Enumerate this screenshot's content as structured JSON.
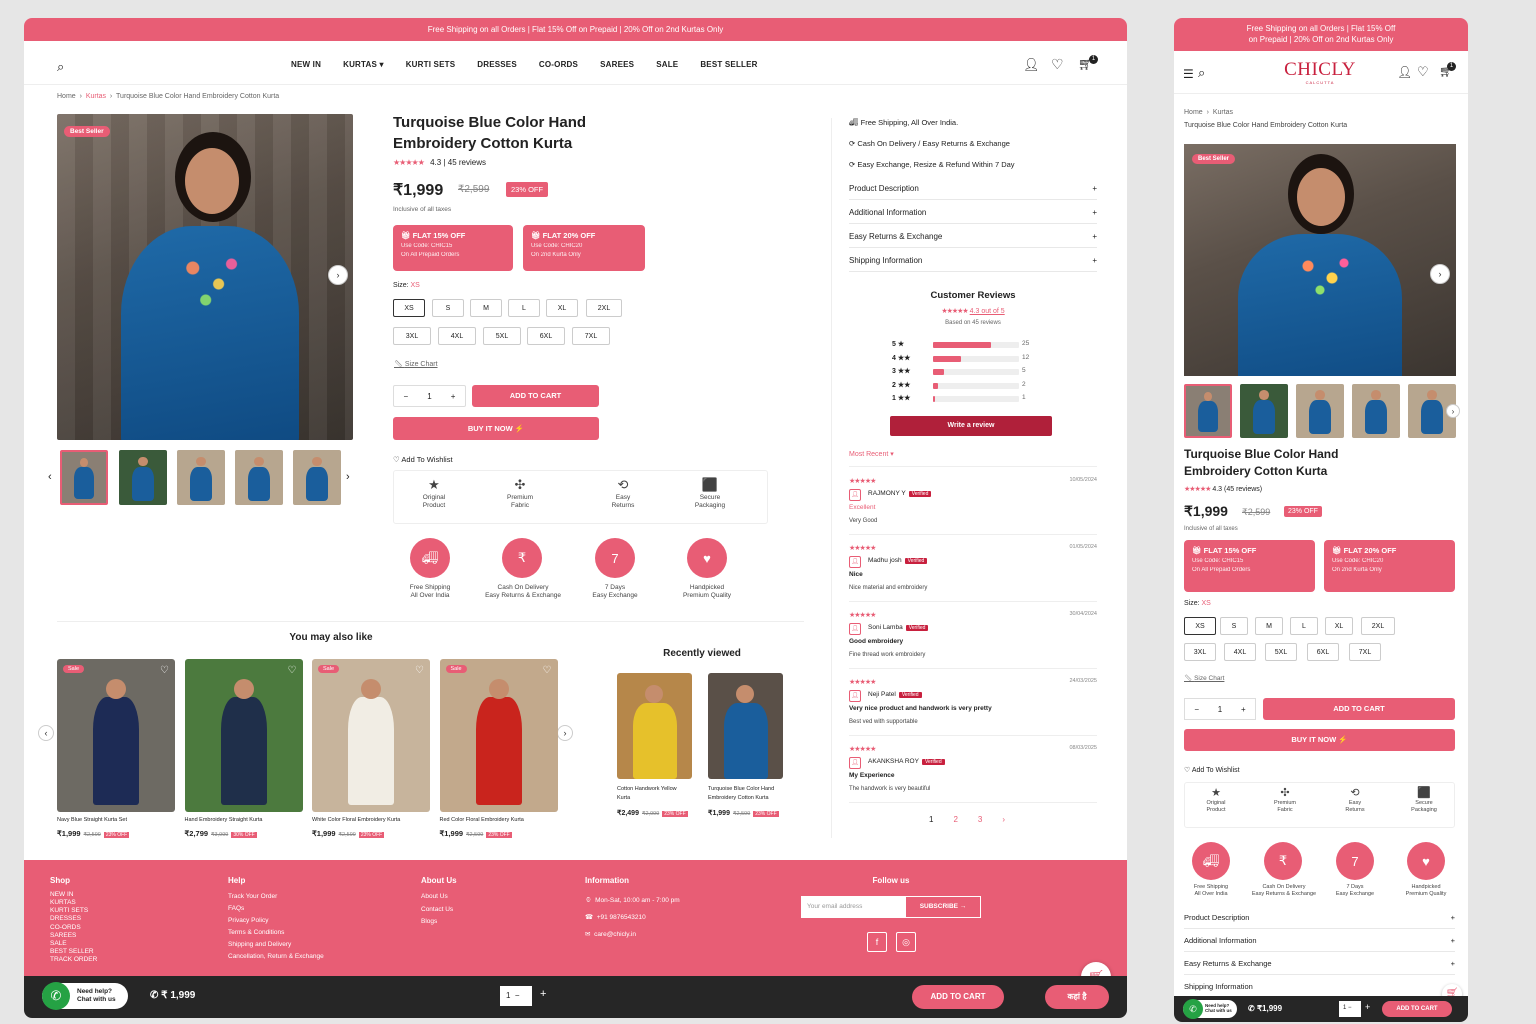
{
  "announcement": "Free Shipping on all Orders | Flat 15% Off on Prepaid | 20% Off on 2nd Kurtas Only",
  "mobile_announcement": [
    "Free Shipping on all Orders | Flat 15% Off",
    "on Prepaid | 20% Off on 2nd Kurtas Only"
  ],
  "brand": {
    "logo": "CHICLY",
    "sub": "CALCUTTA"
  },
  "nav": [
    "NEW IN",
    "KURTAS",
    "KURTI SETS",
    "DRESSES",
    "CO-ORDS",
    "SAREES",
    "SALE",
    "BEST SELLER"
  ],
  "cart_count": "1",
  "breadcrumb": {
    "home": "Home",
    "cat": "Kurtas",
    "current": "Turquoise Blue Color Hand Embroidery Cotton Kurta"
  },
  "product": {
    "badge": "Best Seller",
    "title_l1": "Turquoise Blue Color Hand",
    "title_l2": "Embroidery Cotton Kurta",
    "rating_text": "4.3 | 45 reviews",
    "mobile_rating_text": "4.3 (45 reviews)",
    "price": "₹1,999",
    "mrp": "₹2,599",
    "discount": "23% OFF",
    "tax_note": "Inclusive of all taxes",
    "size_label": "Size:",
    "size_selected": "XS",
    "sizes": [
      "XS",
      "S",
      "M",
      "L",
      "XL",
      "2XL",
      "3XL",
      "4XL",
      "5XL",
      "6XL",
      "7XL"
    ],
    "size_chart": "Size Chart",
    "qty": "1",
    "add_to_cart": "ADD TO CART",
    "buy_now": "BUY IT NOW",
    "wishlist": "Add To Wishlist"
  },
  "promos": [
    {
      "title": "FLAT 15% OFF",
      "code": "Use Code: CHIC15",
      "note": "On All Prepaid Orders"
    },
    {
      "title": "FLAT 20% OFF",
      "code": "Use Code: CHIC20",
      "note": "On 2nd Kurta Only"
    }
  ],
  "features": [
    {
      "l1": "Original",
      "l2": "Product",
      "icon": "star-icon"
    },
    {
      "l1": "Premium",
      "l2": "Fabric",
      "icon": "fabric-icon"
    },
    {
      "l1": "Easy",
      "l2": "Returns",
      "icon": "return-icon"
    },
    {
      "l1": "Secure",
      "l2": "Packaging",
      "icon": "box-icon"
    }
  ],
  "badges": [
    {
      "l1": "Free Shipping",
      "l2": "All Over India"
    },
    {
      "l1": "Cash On Delivery",
      "l2": "Easy Returns & Exchange"
    },
    {
      "l1": "7 Days",
      "l2": "Easy Exchange"
    },
    {
      "l1": "Handpicked",
      "l2": "Premium Quality"
    }
  ],
  "perks": [
    "Free Shipping, All Over India.",
    "Cash On Delivery / Easy Returns & Exchange",
    "Easy Exchange, Resize & Refund Within 7 Day"
  ],
  "accordion": [
    "Product Description",
    "Additional Information",
    "Easy Returns & Exchange",
    "Shipping Information"
  ],
  "reviews": {
    "heading": "Customer Reviews",
    "avg": "4.3 out of 5",
    "based": "Based on 45 reviews",
    "dist": [
      {
        "label": "5 ★",
        "count": "25",
        "frac": 0.56
      },
      {
        "label": "4 ★★",
        "count": "12",
        "frac": 0.27
      },
      {
        "label": "3 ★★",
        "count": "5",
        "frac": 0.11
      },
      {
        "label": "2 ★★",
        "count": "2",
        "frac": 0.05
      },
      {
        "label": "1 ★★",
        "count": "1",
        "frac": 0.02
      }
    ],
    "write": "Write a review",
    "sort": "Most Recent",
    "list": [
      {
        "name": "RAJMONY Y",
        "date": "10/05/2024",
        "title": "Excellent",
        "body": "Very Good"
      },
      {
        "name": "Madhu josh",
        "date": "01/05/2024",
        "title": "Nice",
        "body": "Nice material and embroidery"
      },
      {
        "name": "Soni Lamba",
        "date": "30/04/2024",
        "title": "Good embroidery",
        "body": "Fine thread work embroidery"
      },
      {
        "name": "Neji Patel",
        "date": "24/03/2025",
        "title": "Very nice product and handwork is very pretty",
        "body": "Best ved with supportable"
      },
      {
        "name": "AKANKSHA ROY",
        "date": "08/03/2025",
        "title": "My Experience",
        "body": "The handwork is very beautiful"
      }
    ],
    "verified": "Verified",
    "pages": [
      "1",
      "2",
      "3",
      "›"
    ]
  },
  "also_like": {
    "heading": "You may also like",
    "items": [
      {
        "name": "Navy Blue Straight Kurta Set",
        "price": "₹1,999",
        "mrp": "₹2,599",
        "off": "23% OFF",
        "sale": "Sale"
      },
      {
        "name": "Hand Embroidery Straight Kurta",
        "price": "₹2,799",
        "mrp": "₹3,999",
        "off": "30% OFF",
        "sale": ""
      },
      {
        "name": "White Color Floral Embroidery Kurta",
        "price": "₹1,999",
        "mrp": "₹2,599",
        "off": "23% OFF",
        "sale": "Sale"
      },
      {
        "name": "Red Color Floral Embroidery Kurta",
        "price": "₹1,999",
        "mrp": "₹2,599",
        "off": "23% OFF",
        "sale": "Sale"
      }
    ]
  },
  "recent": {
    "heading": "Recently viewed",
    "items": [
      {
        "l1": "Cotton Handwork Yellow",
        "l2": "Kurta",
        "price": "₹2,499",
        "mrp": "₹2,999",
        "off": "23% OFF"
      },
      {
        "l1": "Turquoise Blue Color Hand",
        "l2": "Embroidery Cotton Kurta",
        "price": "₹1,999",
        "mrp": "₹2,599",
        "off": "23% OFF"
      }
    ]
  },
  "footer": {
    "shop_h": "Shop",
    "shop": [
      "NEW IN",
      "KURTAS",
      "KURTI SETS",
      "DRESSES",
      "CO-ORDS",
      "SAREES",
      "SALE",
      "BEST SELLER",
      "TRACK ORDER"
    ],
    "help_h": "Help",
    "help": [
      "Track Your Order",
      "FAQs",
      "Privacy Policy",
      "Terms & Conditions",
      "Shipping and Delivery",
      "Cancellation, Return & Exchange"
    ],
    "about_h": "About Us",
    "about": [
      "About Us",
      "Contact Us",
      "Blogs"
    ],
    "info_h": "Information",
    "hours": "Mon-Sat, 10:00 am - 7:00 pm",
    "phone": "+91 9876543210",
    "email": "care@chicly.in",
    "follow_h": "Follow us",
    "email_placeholder": "Your email address",
    "subscribe": "SUBSCRIBE →"
  },
  "sticky": {
    "help_l1": "Need help?",
    "help_l2": "Chat with us",
    "price": "₹ 1,999",
    "qty": "1",
    "add": "ADD TO CART",
    "buy": "कहां है"
  },
  "mobile_sticky": {
    "help_l1": "Need help?",
    "help_l2": "Chat with us",
    "price": "₹1,999",
    "qty": "1",
    "add": "ADD TO CART"
  },
  "colors": {
    "brand": "#e85d75",
    "dark": "#b0203a",
    "logo": "#c8203e"
  }
}
